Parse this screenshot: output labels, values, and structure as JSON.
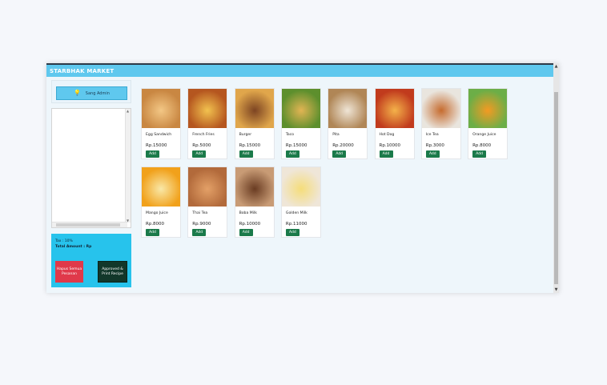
{
  "window": {
    "title": "STARBHAK MARKET"
  },
  "sidebar": {
    "admin_button": "Sang Admin",
    "tax_label": "Tax : 10%",
    "total_label": "Total Amount : Rp",
    "clear_button": "Hapus Semua Pesanan",
    "approve_button": "Approved & Print Recipe"
  },
  "menu": {
    "add_label": "Add",
    "items": [
      {
        "name": "Egg Sandwich",
        "price": "Rp.15000",
        "colors": [
          "#f3c785",
          "#c98742"
        ]
      },
      {
        "name": "French Fries",
        "price": "Rp.5000",
        "colors": [
          "#f2c24f",
          "#b5561f"
        ]
      },
      {
        "name": "Burger",
        "price": "Rp.15000",
        "colors": [
          "#7d4422",
          "#e0a64b"
        ]
      },
      {
        "name": "Taco",
        "price": "Rp.15000",
        "colors": [
          "#e2b453",
          "#5d8f2d"
        ]
      },
      {
        "name": "Pita",
        "price": "Rp.20000",
        "colors": [
          "#efe5d6",
          "#b08656"
        ]
      },
      {
        "name": "Hot Dog",
        "price": "Rp.10000",
        "colors": [
          "#f4b24a",
          "#c13b1d"
        ]
      },
      {
        "name": "Ice Tea",
        "price": "Rp.3000",
        "colors": [
          "#c66b2e",
          "#e9e5de"
        ]
      },
      {
        "name": "Orange Juice",
        "price": "Rp.8000",
        "colors": [
          "#f49a22",
          "#6cae47"
        ]
      },
      {
        "name": "Mango Juice",
        "price": "Rp.8000",
        "colors": [
          "#f9e8a8",
          "#f1a11b"
        ]
      },
      {
        "name": "Thai Tea",
        "price": "Rp.9000",
        "colors": [
          "#e3a067",
          "#b26a3b"
        ]
      },
      {
        "name": "Boba Milk",
        "price": "Rp.10000",
        "colors": [
          "#6a3c22",
          "#c89b75"
        ]
      },
      {
        "name": "Golden Milk",
        "price": "Rp.11000",
        "colors": [
          "#f5dd7a",
          "#efe6d8"
        ]
      }
    ]
  }
}
